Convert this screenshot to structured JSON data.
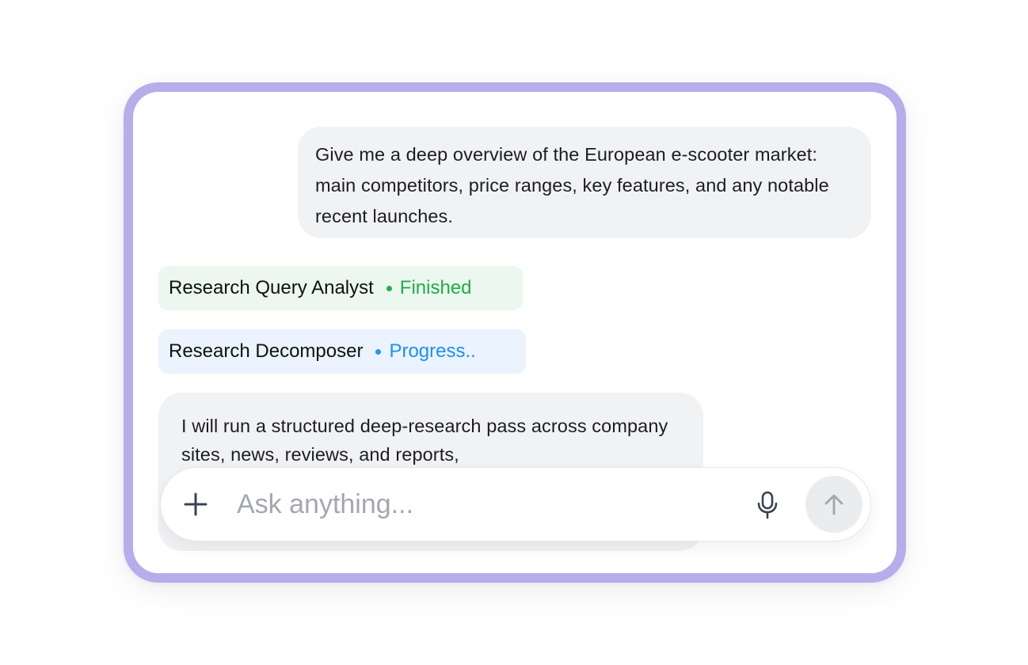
{
  "theme": {
    "frame_color": "#b8aceb",
    "bubble_bg": "#f1f2f4",
    "finished_color": "#1fab4a",
    "progress_color": "#1f8ff0"
  },
  "messages": {
    "user": "Give me a deep overview of the European e-scooter market: main competitors, price ranges, key features, and any notable recent launches.",
    "assistant": "I will run a structured deep-research pass across company sites, news, reviews, and reports,"
  },
  "agents": [
    {
      "name": "Research Query Analyst",
      "status": "Finished"
    },
    {
      "name": "Research Decomposer",
      "status": "Progress.."
    }
  ],
  "composer": {
    "placeholder": "Ask anything...",
    "value": "",
    "icons": {
      "add": "plus-icon",
      "voice": "microphone-icon",
      "send": "arrow-up-icon"
    }
  }
}
